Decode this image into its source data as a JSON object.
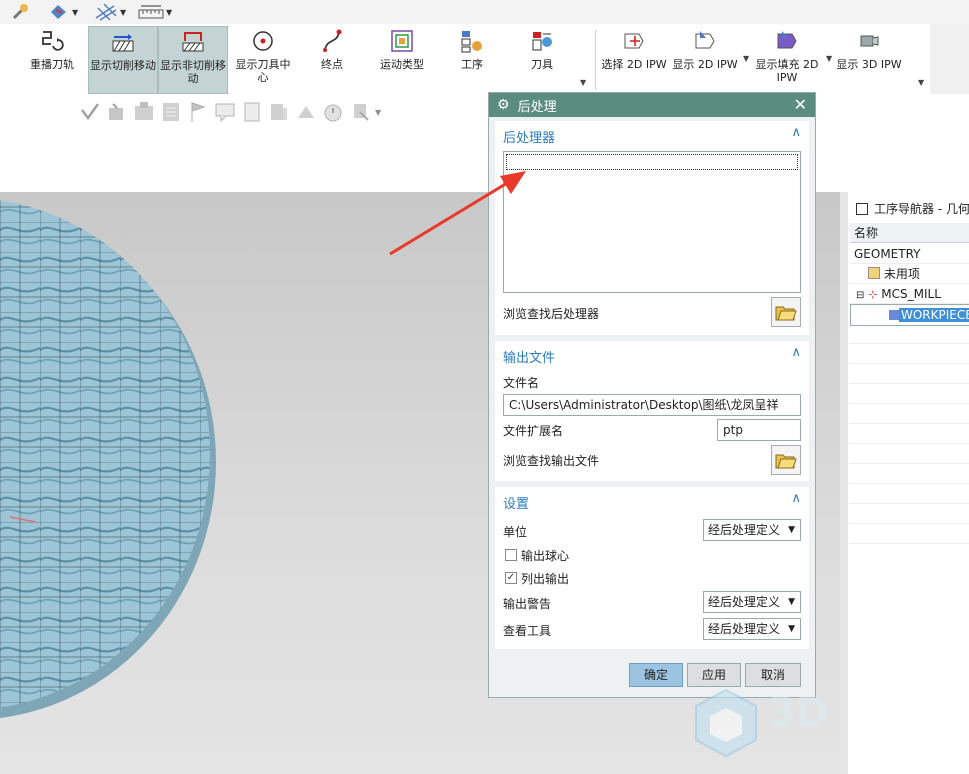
{
  "ribbon": {
    "buttons": [
      {
        "label": "重播刀轨"
      },
      {
        "label": "显示切削移动"
      },
      {
        "label": "显示非切削移动"
      },
      {
        "label": "显示刀具中心"
      },
      {
        "label": "终点"
      },
      {
        "label": "运动类型"
      },
      {
        "label": "工序"
      },
      {
        "label": "刀具"
      },
      {
        "label": "选择 2D IPW"
      },
      {
        "label": "显示 2D IPW"
      },
      {
        "label": "显示填充 2D IPW"
      },
      {
        "label": "显示 3D IPW"
      }
    ]
  },
  "navigator": {
    "title": "工序导航器 - 几何",
    "column_header": "名称",
    "rows": [
      "GEOMETRY",
      "未用项",
      "MCS_MILL",
      "WORKPIECE"
    ]
  },
  "dialog": {
    "title": "后处理",
    "postprocessor": {
      "header": "后处理器",
      "browse_label": "浏览查找后处理器"
    },
    "output_file": {
      "header": "输出文件",
      "filename_label": "文件名",
      "filename_value": "C:\\Users\\Administrator\\Desktop\\图纸\\龙凤呈祥",
      "extension_label": "文件扩展名",
      "extension_value": "ptp",
      "browse_label": "浏览查找输出文件"
    },
    "settings": {
      "header": "设置",
      "unit_label": "单位",
      "unit_value": "经后处理定义",
      "ball_center_label": "输出球心",
      "ball_center_checked": false,
      "list_output_label": "列出输出",
      "list_output_checked": true,
      "warning_label": "输出警告",
      "warning_value": "经后处理定义",
      "view_tool_label": "查看工具",
      "view_tool_value": "经后处理定义"
    },
    "buttons": {
      "ok": "确定",
      "apply": "应用",
      "cancel": "取消"
    }
  },
  "watermark": {
    "text": "3D"
  },
  "colors": {
    "title_bar": "#5b8c80",
    "section_header": "#2a7cc0",
    "selection": "#3d8fd8",
    "annotation_arrow": "#e8392a"
  }
}
